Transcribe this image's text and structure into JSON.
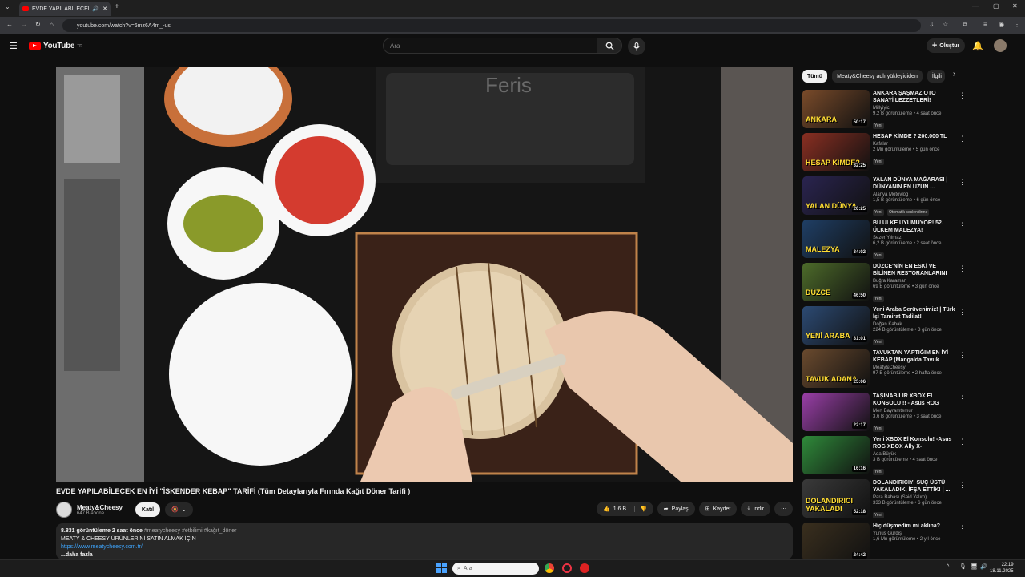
{
  "browser": {
    "tab_title": "EVDE YAPILABİLECEK EN İYİ",
    "url": "youtube.com/watch?v=6mz6A4m_-us"
  },
  "youtube": {
    "logo_text": "YouTube",
    "region": "TR",
    "search_placeholder": "Ara",
    "create_label": "Oluştur"
  },
  "video": {
    "title": "EVDE YAPILABİLECEK EN İYİ \"İSKENDER KEBAP\" TARİFİ (Tüm Detaylarıyla Fırında Kağıt Döner Tarifi )",
    "channel": "Meaty&Cheesy",
    "subscribers": "647 B abone",
    "join_label": "Katıl",
    "likes": "1,6 B",
    "share_label": "Paylaş",
    "save_label": "Kaydet",
    "download_label": "İndir",
    "views": "8.831 görüntüleme",
    "age": "2 saat önce",
    "hashtags": "#meatycheesy #etbilimi #kağıt_döner",
    "desc_line": "MEATY & CHEESY ÜRÜNLERİNİ SATIN ALMAK İÇİN",
    "desc_link": "https://www.meatycheesy.com.tr/",
    "more_label": "...daha fazla",
    "scene_brand": "Feris"
  },
  "chips": [
    "Tümü",
    "Meaty&Cheesy adlı yükleyiciden",
    "İlgili"
  ],
  "recommendations": [
    {
      "title": "ANKARA ŞAŞMAZ OTO SANAYİ LEZZETLERİ!",
      "channel": "Millyiyici",
      "meta": "9,2 B görüntüleme • 4 saat önce",
      "badge": "Yeni",
      "duration": "50:17",
      "thumb_text": "ANKARA",
      "color": "#7a4b2a"
    },
    {
      "title": "HESAP KİMDE ? 200.000 TL",
      "channel": "Kafalar",
      "meta": "2 Mn görüntüleme • 5 gün önce",
      "badge": "Yeni",
      "duration": "32:25",
      "thumb_text": "HESAP KİMDE?",
      "color": "#8a2f22"
    },
    {
      "title": "YALAN DÜNYA MAĞARASI | DÜNYANIN EN UZUN ...",
      "channel": "Alanya Motovlog",
      "meta": "1,5 B görüntüleme • 6 gün önce",
      "badge": "Yeni",
      "badge2": "Otomatik seslendirme",
      "duration": "20:25",
      "thumb_text": "YALAN DÜNYA",
      "color": "#2a2450"
    },
    {
      "title": "BU ÜLKE UYUMUYOR! 52. ÜLKEM MALEZYA!",
      "channel": "Sezer Yılmaz",
      "meta": "6,2 B görüntüleme • 2 saat önce",
      "badge": "Yeni",
      "duration": "34:02",
      "thumb_text": "MALEZYA",
      "color": "#1f3f66"
    },
    {
      "title": "DÜZCE'NİN EN ESKİ VE BİLİNEN RESTORANLARINI GEZDİM!",
      "channel": "Buğra Karaman",
      "meta": "69 B görüntüleme • 3 gün önce",
      "badge": "Yeni",
      "duration": "46:50",
      "thumb_text": "DÜZCE",
      "color": "#4d6b2a"
    },
    {
      "title": "Yeni Araba Serüvenimiz! | Türk İşi Tamirat Tadilat!",
      "channel": "Doğan Kabak",
      "meta": "224 B görüntüleme • 3 gün önce",
      "badge": "Yeni",
      "duration": "31:01",
      "thumb_text": "YENİ ARABA",
      "color": "#2c4a73"
    },
    {
      "title": "TAVUKTAN YAPTIĞIM EN İYİ KEBAP (Mangalda Tavuk Adan...",
      "channel": "Meaty&Cheesy",
      "meta": "97 B görüntüleme • 2 hafta önce",
      "badge": "",
      "duration": "25:06",
      "thumb_text": "TAVUK ADANA",
      "color": "#6a4a2e"
    },
    {
      "title": "TAŞINABİLİR XBOX EL KONSOLU !! - Asus ROG XBOX ...",
      "channel": "Mert Bayramtemur",
      "meta": "3,6 B görüntüleme • 3 saat önce",
      "badge": "Yeni",
      "duration": "22:17",
      "thumb_text": "",
      "color": "#9a3fa8"
    },
    {
      "title": "Yeni XBOX El Konsolu! -Asus ROG XBOX Ally X-",
      "channel": "Ada Büyük",
      "meta": "3 B görüntüleme • 4 saat önce",
      "badge": "Yeni",
      "duration": "16:16",
      "thumb_text": "",
      "color": "#2f8a3a"
    },
    {
      "title": "DOLANDIRICIYI SUÇ ÜSTÜ YAKALADIK, İFŞA ETTİK! | ...",
      "channel": "Para Babası (Said Yalım)",
      "meta": "333 B görüntüleme • 6 gün önce",
      "badge": "Yeni",
      "duration": "52:18",
      "thumb_text": "DOLANDIRICI YAKALADI",
      "color": "#3a3a3a"
    },
    {
      "title": "Hiç düşmedim mi aklına?",
      "channel": "Yunus Gürdiş",
      "meta": "1,6 Mn görüntüleme • 2 yıl önce",
      "badge": "",
      "duration": "24:42",
      "thumb_text": "",
      "color": "#3a2f1e"
    }
  ],
  "taskbar": {
    "search_placeholder": "Ara",
    "time": "22:19",
    "date": "18.11.2025"
  }
}
